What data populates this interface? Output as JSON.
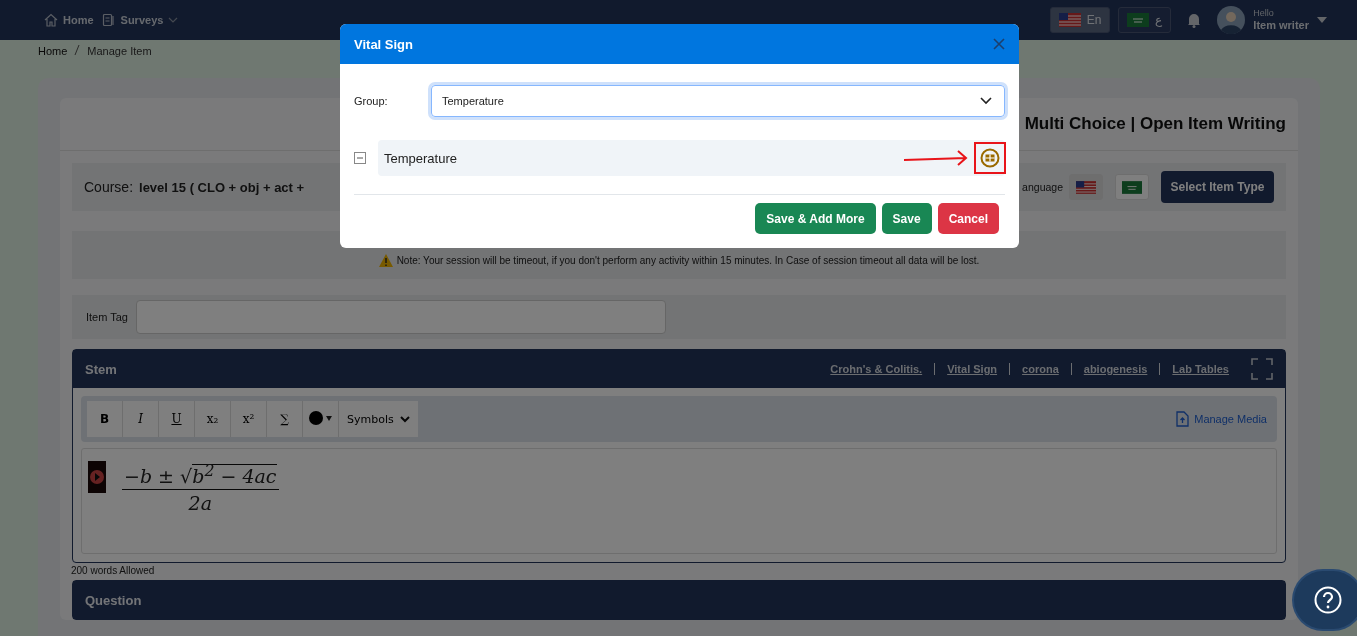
{
  "header": {
    "nav": [
      {
        "label": "Home",
        "kind": "home"
      },
      {
        "label": "Surveys",
        "kind": "surveys"
      }
    ],
    "languages": [
      {
        "label": "En",
        "kind": "us",
        "selected": true
      },
      {
        "label": "ع",
        "kind": "sa",
        "selected": false
      }
    ],
    "greeting": "Hello",
    "user": "Item writer"
  },
  "breadcrumb": [
    "Home",
    "Manage Item"
  ],
  "page": {
    "title": "Multi Choice | Open Item Writing",
    "course_label": "Course:",
    "course": "level 15 ( CLO + obj + act +",
    "language_label": "anguage",
    "flags": [
      {
        "kind": "us",
        "selected": true
      },
      {
        "kind": "sa",
        "selected": false
      }
    ],
    "select_type_button": "Select Item Type",
    "note": "Note: Your session will be timeout, if you don't perform any activity within 15 minutes. In Case of session timeout all data will be lost.",
    "item_tag_label": "Item Tag"
  },
  "stem": {
    "title": "Stem",
    "links": [
      "Crohn's & Colitis.",
      "Vital Sign",
      "corona",
      "abiogenesis",
      "Lab Tables"
    ],
    "toolbar": [
      "B",
      "I",
      "U",
      "x₂",
      "x²",
      "∑"
    ],
    "symbols": "Symbols",
    "manage_media": "Manage Media",
    "formula": {
      "numerator_lead": "−b ±",
      "radical": "√",
      "radicand": "b$^{2}$ − 4ac",
      "denominator": "2a"
    },
    "limit": "200 words Allowed"
  },
  "question": {
    "title": "Question"
  },
  "modal": {
    "title": "Vital Sign",
    "group_label": "Group:",
    "group_value": "Temperature",
    "tree": [
      {
        "label": "Temperature",
        "expanded": true
      }
    ],
    "buttons": [
      {
        "label": "Save & Add More",
        "kind": "success"
      },
      {
        "label": "Save",
        "kind": "success"
      },
      {
        "label": "Cancel",
        "kind": "danger"
      }
    ]
  }
}
